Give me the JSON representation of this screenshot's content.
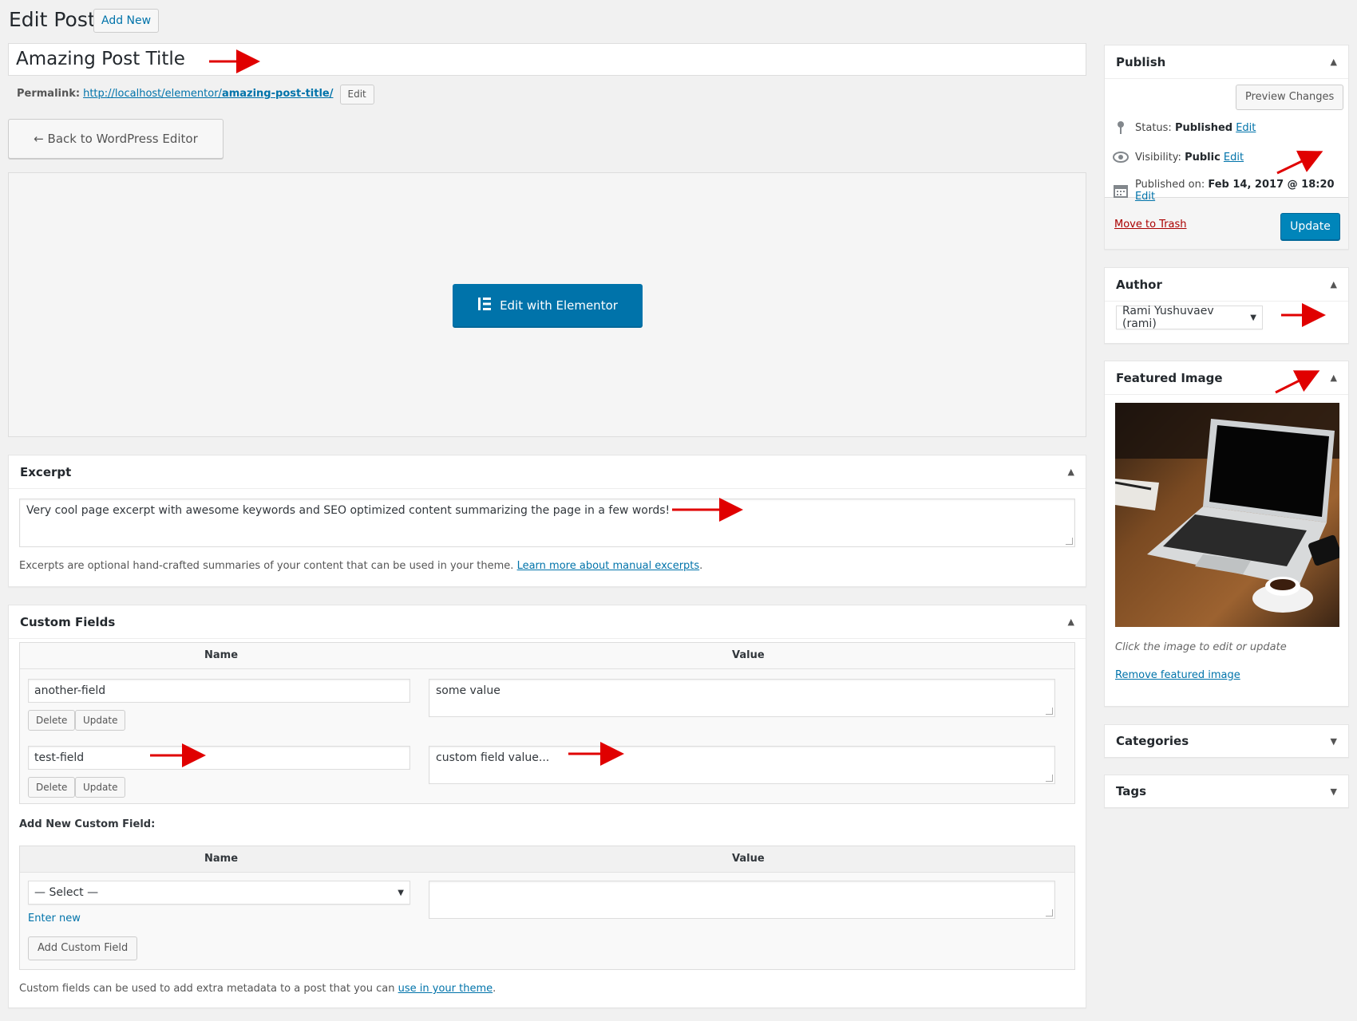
{
  "header": {
    "title": "Edit Post",
    "add_new": "Add New"
  },
  "post": {
    "title": "Amazing Post Title",
    "permalink_label": "Permalink:",
    "permalink_base": "http://localhost/elementor/",
    "permalink_slug": "amazing-post-title/",
    "permalink_edit": "Edit",
    "back_button": "← Back to WordPress Editor",
    "elementor_button": "Edit with Elementor"
  },
  "excerpt": {
    "heading": "Excerpt",
    "value": "Very cool page excerpt with awesome keywords and SEO optimized content summarizing the page in a few words!",
    "help_text": "Excerpts are optional hand-crafted summaries of your content that can be used in your theme.",
    "help_link": "Learn more about manual excerpts",
    "help_end": "."
  },
  "custom_fields": {
    "heading": "Custom Fields",
    "col_name": "Name",
    "col_value": "Value",
    "rows": [
      {
        "name": "another-field",
        "value": "some value",
        "delete": "Delete",
        "update": "Update"
      },
      {
        "name": "test-field",
        "value": "custom field value...",
        "delete": "Delete",
        "update": "Update"
      }
    ],
    "add_new_label": "Add New Custom Field:",
    "select_placeholder": "— Select —",
    "enter_new": "Enter new",
    "add_button": "Add Custom Field",
    "footer_text": "Custom fields can be used to add extra metadata to a post that you can",
    "footer_link": "use in your theme",
    "footer_end": "."
  },
  "publish": {
    "heading": "Publish",
    "preview": "Preview Changes",
    "status_label": "Status:",
    "status_value": "Published",
    "visibility_label": "Visibility:",
    "visibility_value": "Public",
    "published_label": "Published on:",
    "published_value": "Feb 14, 2017 @ 18:20",
    "edit": "Edit",
    "trash": "Move to Trash",
    "update": "Update"
  },
  "author": {
    "heading": "Author",
    "selected": "Rami Yushuvaev (rami)"
  },
  "featured_image": {
    "heading": "Featured Image",
    "hint": "Click the image to edit or update",
    "remove": "Remove featured image"
  },
  "categories": {
    "heading": "Categories"
  },
  "tags": {
    "heading": "Tags"
  },
  "colors": {
    "primary": "#0073aa",
    "update": "#0085ba",
    "trash": "#a00",
    "arrow": "#e00000"
  },
  "icons": [
    "pin-icon",
    "eye-icon",
    "calendar-icon",
    "elementor-icon",
    "collapse-arrow-icon",
    "annotation-arrow-icon"
  ]
}
